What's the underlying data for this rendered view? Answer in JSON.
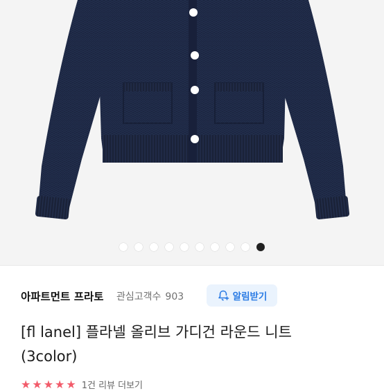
{
  "product": {
    "image_alt": "navy knit cardigan",
    "carousel": {
      "total": 10,
      "active_index": 9
    },
    "colors": {
      "cardigan": "#1c2540",
      "background": "#f4f4f4",
      "button": "#ffffff",
      "accent": "#2a7be4",
      "star": "#f25b6a"
    }
  },
  "shop": {
    "name": "아파트먼트 프라토",
    "follower_label": "관심고객수",
    "follower_count": "903",
    "alarm_icon": "bell-plus-icon",
    "alarm_button": "알림받기"
  },
  "title": {
    "line1": "[fl lanel] 플라넬 올리브 가디건 라운드 니트",
    "line2": "(3color)"
  },
  "rating": {
    "stars": "★★★★★",
    "review_text": "1건 리뷰 더보기"
  }
}
